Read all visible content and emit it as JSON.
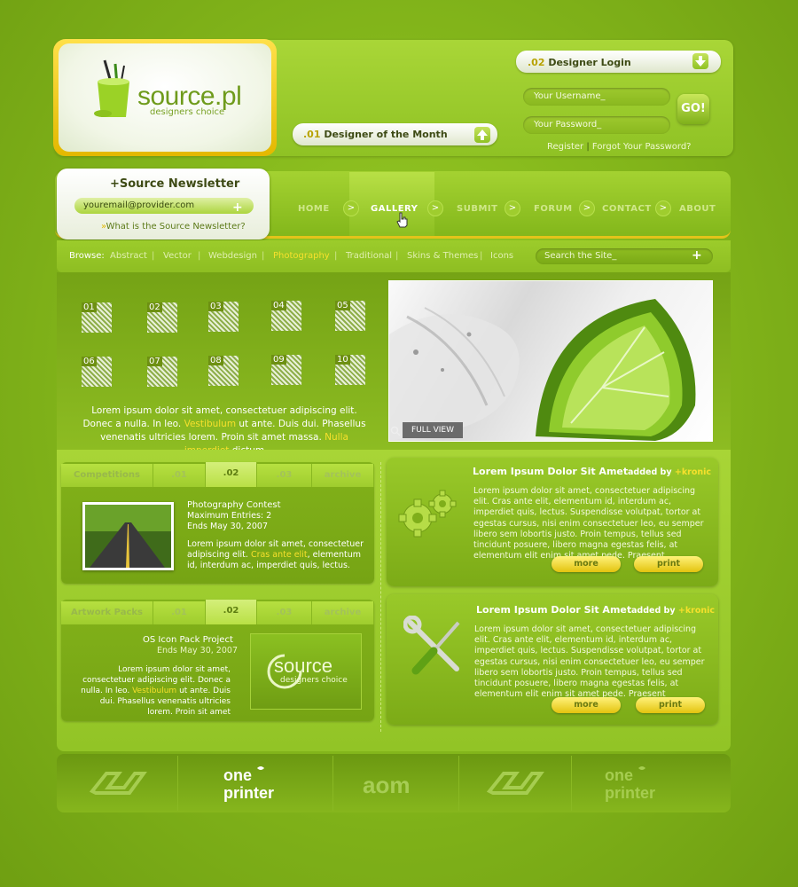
{
  "brand": {
    "logo_text": "source.pl",
    "tagline": "designers choice"
  },
  "designer_month": {
    "number": ".01",
    "label": "Designer of the Month"
  },
  "login": {
    "number": ".02",
    "label": "Designer Login",
    "username_placeholder": "Your Username_",
    "password_placeholder": "Your Password_",
    "go_label": "GO!",
    "register_label": "Register",
    "divider": "|",
    "forgot_label": "Forgot Your Password?"
  },
  "newsletter": {
    "title": "+Source Newsletter",
    "email_value": "youremail@provider.com",
    "plus": "+",
    "link_marker": "»",
    "link": "What is the Source Newsletter?"
  },
  "nav": {
    "items": [
      "HOME",
      "GALLERY",
      "SUBMIT",
      "FORUM",
      "CONTACT",
      "ABOUT"
    ],
    "active": "GALLERY",
    "arrow": ">"
  },
  "browse": {
    "label": "Browse:",
    "items": [
      "Abstract",
      "Vector",
      "Webdesign",
      "Photography",
      "Traditional",
      "Skins & Themes",
      "Icons"
    ],
    "active": "Photography",
    "divider": "|"
  },
  "search": {
    "placeholder": "Search the Site_",
    "plus": "+"
  },
  "gallery": {
    "thumbs": [
      "01",
      "02",
      "03",
      "04",
      "05",
      "06",
      "07",
      "08",
      "09",
      "10"
    ],
    "intro_part1": "Lorem ipsum dolor sit amet, consectetuer adipiscing elit. Donec a nulla. In leo. ",
    "intro_link1": "Vestibulum",
    "intro_part2": " ut ante. Duis dui. Phasellus venenatis ultricies lorem. Proin sit amet massa. ",
    "intro_link2": "Nulla imperdiet",
    "intro_part3": " dictum",
    "full_view": "FULL VIEW"
  },
  "competitions": {
    "tabs": [
      "Competitions",
      ".01",
      ".02",
      ".03",
      "archive"
    ],
    "active_tab": ".02",
    "title": "Photography Contest",
    "entries": "Maximum Entries: 2",
    "ends": "Ends May 30, 2007",
    "text1": "Lorem ipsum dolor sit amet, consectetuer adipiscing elit. ",
    "text_link": "Cras ante elit",
    "text2": ", elementum id, interdum ac, imperdiet quis, lectus."
  },
  "artwork": {
    "tabs": [
      "Artwork Packs",
      ".01",
      ".02",
      ".03",
      "archive"
    ],
    "active_tab": ".02",
    "title": "OS Icon Pack Project",
    "ends": "Ends May 30, 2007",
    "text1": "Lorem ipsum dolor sit amet, consectetuer adipiscing elit. Donec a nulla. In leo. ",
    "text_link": "Vestibulum",
    "text2": " ut ante. Duis dui. Phasellus venenatis ultricies lorem. Proin sit amet",
    "logo_big": "source",
    "logo_small": "designers choice"
  },
  "articles": [
    {
      "title": "Lorem Ipsum Dolor Sit Amet",
      "added_by": "added by",
      "author": "+kronic",
      "body": "Lorem ipsum dolor sit amet, consectetuer adipiscing elit. Cras ante elit, elementum id, interdum ac, imperdiet quis, lectus. Suspendisse volutpat, tortor at egestas cursus, nisi enim consectetuer leo, eu semper libero sem lobortis justo. Proin tempus, tellus sed tincidunt posuere, libero magna egestas felis, at elementum elit enim sit amet pede. Praesent",
      "more": "more",
      "print": "print",
      "icon": "gears-icon"
    },
    {
      "title": "Lorem Ipsum Dolor Sit Amet",
      "added_by": "added by",
      "author": "+kronic",
      "body": "Lorem ipsum dolor sit amet, consectetuer adipiscing elit. Cras ante elit, elementum id, interdum ac, imperdiet quis, lectus. Suspendisse volutpat, tortor at egestas cursus, nisi enim consectetuer leo, eu semper libero sem lobortis justo. Proin tempus, tellus sed tincidunt posuere, libero magna egestas felis, at elementum elit enim sit amet pede. Praesent",
      "more": "more",
      "print": "print",
      "icon": "tools-icon"
    }
  ],
  "footer_partners": [
    "deviantART",
    "OnePrinter",
    "aom",
    "deviantART",
    "OnePrinter"
  ],
  "colors": {
    "accent_yellow": "#f6e02c",
    "main_green": "#8fc224",
    "dark_green": "#6f9f12"
  }
}
